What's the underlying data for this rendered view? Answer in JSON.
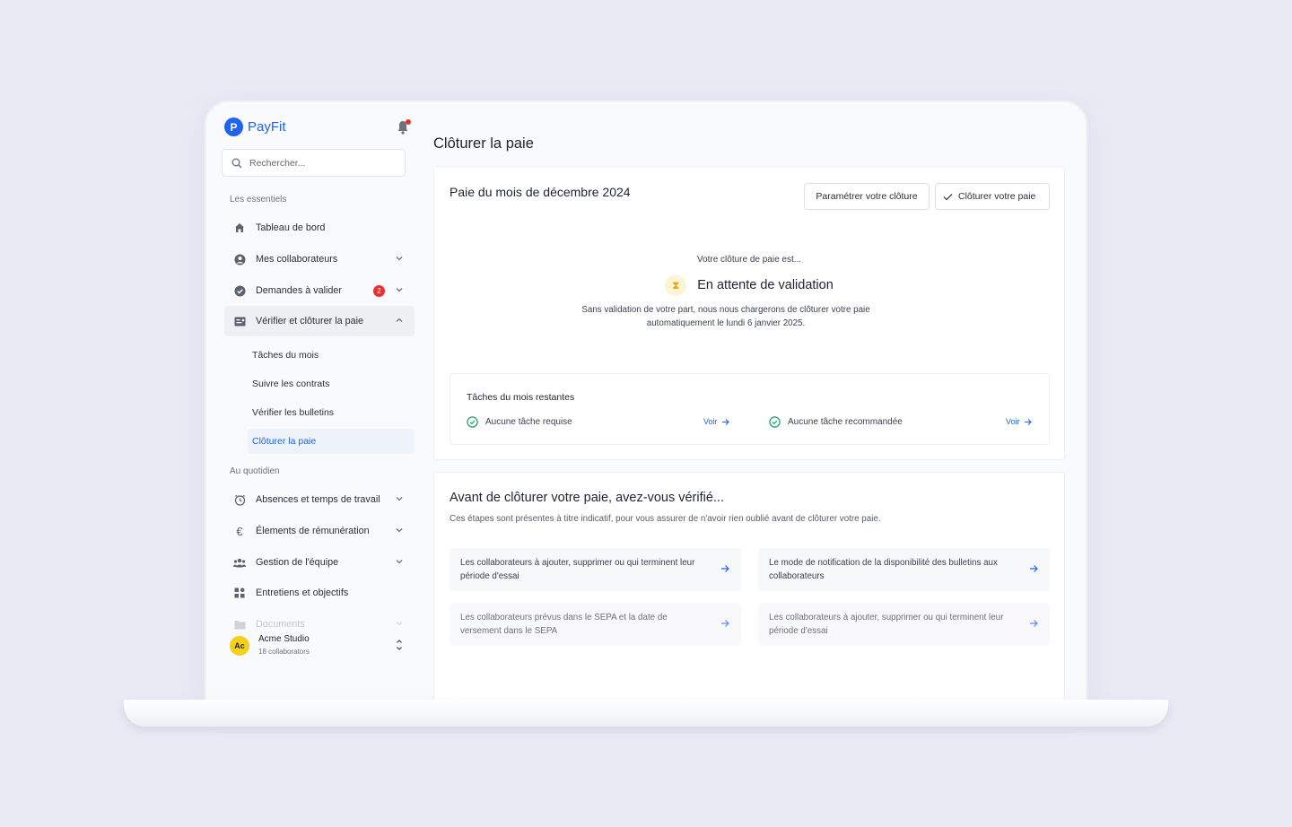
{
  "app": {
    "name": "PayFit"
  },
  "search": {
    "placeholder": "Rechercher..."
  },
  "sidebar": {
    "section1": "Les essentiels",
    "items": [
      {
        "label": "Tableau de bord",
        "icon": "home-icon"
      },
      {
        "label": "Mes collaborateurs",
        "icon": "user-circle-icon"
      },
      {
        "label": "Demandes à valider",
        "icon": "check-badge-icon",
        "badge": "2"
      },
      {
        "label": "Vérifier et clôturer la paie",
        "icon": "payslip-icon"
      }
    ],
    "subitems": [
      {
        "label": "Tâches du mois"
      },
      {
        "label": "Suivre les contrats"
      },
      {
        "label": "Vérifier les bulletins"
      },
      {
        "label": "Clôturer la paie"
      }
    ],
    "section2": "Au quotidien",
    "items2": [
      {
        "label": "Absences et temps de travail",
        "icon": "alarm-clock-icon"
      },
      {
        "label": "Élements de rémunération",
        "icon": "euro-icon"
      },
      {
        "label": "Gestion de l'équipe",
        "icon": "team-icon"
      },
      {
        "label": "Entretiens et objectifs",
        "icon": "grid-icon"
      },
      {
        "label": "Documents",
        "icon": "folder-icon"
      }
    ],
    "account": {
      "initials": "Ac",
      "name": "Acme Studio",
      "sub": "18 collaborators"
    }
  },
  "main": {
    "page_title": "Clôturer la paie",
    "card1": {
      "title": "Paie du mois de décembre 2024",
      "btn_settings": "Paramétrer votre clôture",
      "btn_close": "Clôturer votre paie",
      "status_label": "Votre clôture de paie est...",
      "status_value": "En attente de validation",
      "status_desc": "Sans validation de votre part, nous nous chargerons de clôturer votre paie automatiquement le lundi 6 janvier 2025.",
      "tasks_title": "Tâches du mois restantes",
      "task_required": "Aucune tâche requise",
      "task_recommended": "Aucune tâche recommandée",
      "voir": "Voir"
    },
    "card2": {
      "title": "Avant de clôturer votre paie, avez-vous vérifié...",
      "subtitle": "Ces étapes sont présentes à titre indicatif, pour vous assurer de n'avoir rien oublié avant de clôturer votre paie.",
      "tiles": [
        "Les collaborateurs à ajouter, supprimer ou qui terminent leur période d'essai",
        "Le mode de notification de la disponibilité des bulletins aux collaborateurs",
        "Les collaborateurs prévus dans le SEPA et la date de versement dans le SEPA",
        "Les collaborateurs à ajouter, supprimer ou qui terminent leur période d'essai"
      ]
    }
  },
  "colors": {
    "accent": "#1f63f0",
    "success": "#1aa163",
    "danger": "#e5312f",
    "warning": "#e4a600"
  }
}
